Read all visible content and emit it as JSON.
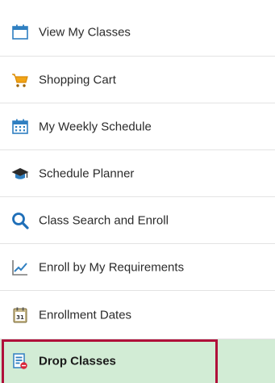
{
  "nav": {
    "items": [
      {
        "label": "View My Classes",
        "icon": "calendar-icon"
      },
      {
        "label": "Shopping Cart",
        "icon": "shopping-cart-icon"
      },
      {
        "label": "My Weekly Schedule",
        "icon": "weekly-calendar-icon"
      },
      {
        "label": "Schedule Planner",
        "icon": "graduation-cap-icon"
      },
      {
        "label": "Class Search and Enroll",
        "icon": "search-icon"
      },
      {
        "label": "Enroll by My Requirements",
        "icon": "line-chart-icon"
      },
      {
        "label": "Enrollment Dates",
        "icon": "calendar-date-icon"
      },
      {
        "label": "Drop Classes",
        "icon": "drop-list-icon",
        "selected": true
      }
    ]
  },
  "colors": {
    "selected_background": "#d2ecd5",
    "selected_outline": "#b0103a",
    "divider": "#e3e3e3",
    "icon_blue": "#2f7fc1",
    "cart_orange": "#f2a416"
  }
}
